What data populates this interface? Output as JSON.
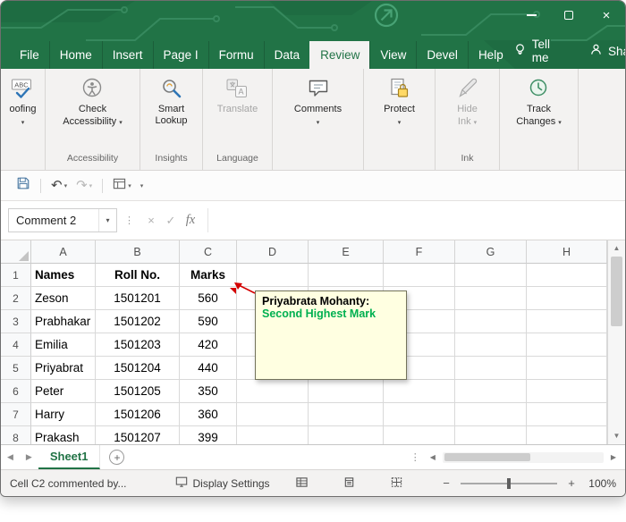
{
  "tabs": {
    "items": [
      {
        "label": "File",
        "active": false
      },
      {
        "label": "Home",
        "active": false
      },
      {
        "label": "Insert",
        "active": false
      },
      {
        "label": "Page I",
        "active": false
      },
      {
        "label": "Formu",
        "active": false
      },
      {
        "label": "Data",
        "active": false
      },
      {
        "label": "Review",
        "active": true
      },
      {
        "label": "View",
        "active": false
      },
      {
        "label": "Devel",
        "active": false
      },
      {
        "label": "Help",
        "active": false
      }
    ],
    "tell_me": "Tell me",
    "share": "Share"
  },
  "ribbon": {
    "proofing_label": "oofing",
    "check_accessibility": {
      "line1": "Check",
      "line2": "Accessibility"
    },
    "smart_lookup": {
      "line1": "Smart",
      "line2": "Lookup"
    },
    "translate_label": "Translate",
    "comments_label": "Comments",
    "protect_label": "Protect",
    "hide_ink": {
      "line1": "Hide",
      "line2": "Ink"
    },
    "track_changes": {
      "line1": "Track",
      "line2": "Changes"
    },
    "group_labels": {
      "accessibility": "Accessibility",
      "insights": "Insights",
      "language": "Language",
      "ink": "Ink"
    }
  },
  "formula_bar": {
    "name_box": "Comment 2",
    "cancel": "×",
    "enter": "✓",
    "fx": "fx",
    "formula": ""
  },
  "sheet": {
    "column_headers": [
      "A",
      "B",
      "C",
      "D",
      "E",
      "F",
      "G",
      "H"
    ],
    "rows": [
      {
        "n": "1",
        "A": "Names",
        "B": "Roll No.",
        "C": "Marks"
      },
      {
        "n": "2",
        "A": "Zeson",
        "B": "1501201",
        "C": "560"
      },
      {
        "n": "3",
        "A": "Prabhakar",
        "B": "1501202",
        "C": "590"
      },
      {
        "n": "4",
        "A": "Emilia",
        "B": "1501203",
        "C": "420"
      },
      {
        "n": "5",
        "A": "Priyabrat",
        "B": "1501204",
        "C": "440"
      },
      {
        "n": "6",
        "A": "Peter",
        "B": "1501205",
        "C": "350"
      },
      {
        "n": "7",
        "A": "Harry",
        "B": "1501206",
        "C": "360"
      },
      {
        "n": "8",
        "A": "Prakash",
        "B": "1501207",
        "C": "399"
      }
    ]
  },
  "comment": {
    "author": "Priyabrata Mohanty:",
    "body": "Second Highest Mark",
    "bg": "#ffffe1",
    "body_color": "#00b050"
  },
  "sheet_tabs": {
    "active": "Sheet1"
  },
  "status_bar": {
    "left": "Cell C2 commented by...",
    "display_settings": "Display Settings",
    "zoom": "100%"
  },
  "glyphs": {
    "dropdown": "▾",
    "left_arrow": "◀",
    "right_arrow": "▶",
    "up_arrow": "▲",
    "down_arrow": "▼",
    "zoom_out": "−",
    "zoom_in": "+",
    "add_sheet": "+",
    "close": "×",
    "undo": "↶",
    "redo": "↷",
    "dots": "⋮"
  },
  "colors": {
    "title_green": "#217346",
    "ribbon_bg": "#f3f2f1",
    "comment_green": "#00b050"
  }
}
